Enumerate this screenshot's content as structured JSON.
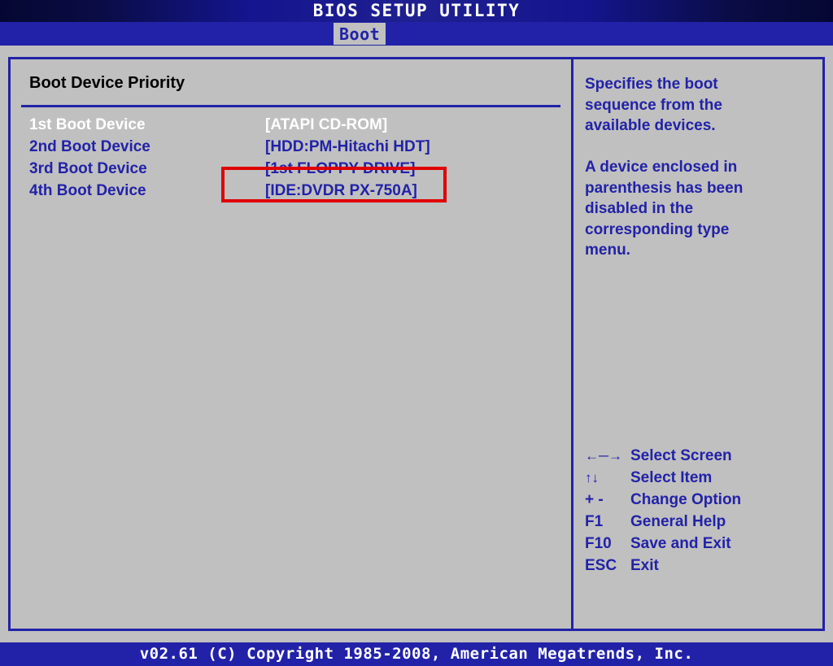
{
  "window": {
    "title": "BIOS SETUP UTILITY",
    "colors": {
      "panel_bg": "#c0c0c0",
      "accent_blue": "#2222a8",
      "title_bar_dark": "#050732",
      "title_bar_bright": "#1f2090",
      "selected_text": "#ffffff",
      "heading_text": "#000000",
      "annotation_red": "#e00000"
    }
  },
  "tabs": [
    {
      "label": "Boot",
      "active": true
    }
  ],
  "main": {
    "section_title": "Boot Device Priority",
    "boot_devices": [
      {
        "label": "1st Boot Device",
        "value": "[ATAPI CD-ROM]",
        "selected": true,
        "annotated": true
      },
      {
        "label": "2nd Boot Device",
        "value": "[HDD:PM-Hitachi HDT]",
        "selected": false,
        "annotated": false
      },
      {
        "label": "3rd Boot Device",
        "value": "[1st FLOPPY DRIVE]",
        "selected": false,
        "annotated": false
      },
      {
        "label": "4th Boot Device",
        "value": "[IDE:DVDR PX-750A]",
        "selected": false,
        "annotated": false
      }
    ]
  },
  "help": {
    "text": "Specifies the boot\nsequence from the\navailable devices.\n\nA device enclosed in\nparenthesis has been\ndisabled in the\ncorresponding type\nmenu."
  },
  "legend": [
    {
      "key": "←─→",
      "desc": "Select Screen",
      "icon": "left-right-arrow-icon"
    },
    {
      "key": "↑↓",
      "desc": "Select Item",
      "icon": "up-down-arrow-icon"
    },
    {
      "key": "+ -",
      "desc": "Change Option",
      "icon": "plus-minus-keys"
    },
    {
      "key": "F1",
      "desc": "General Help",
      "icon": "f1-key"
    },
    {
      "key": "F10",
      "desc": "Save and Exit",
      "icon": "f10-key"
    },
    {
      "key": "ESC",
      "desc": "Exit",
      "icon": "esc-key"
    }
  ],
  "footer": {
    "text": "v02.61 (C) Copyright 1985-2008, American Megatrends, Inc."
  }
}
